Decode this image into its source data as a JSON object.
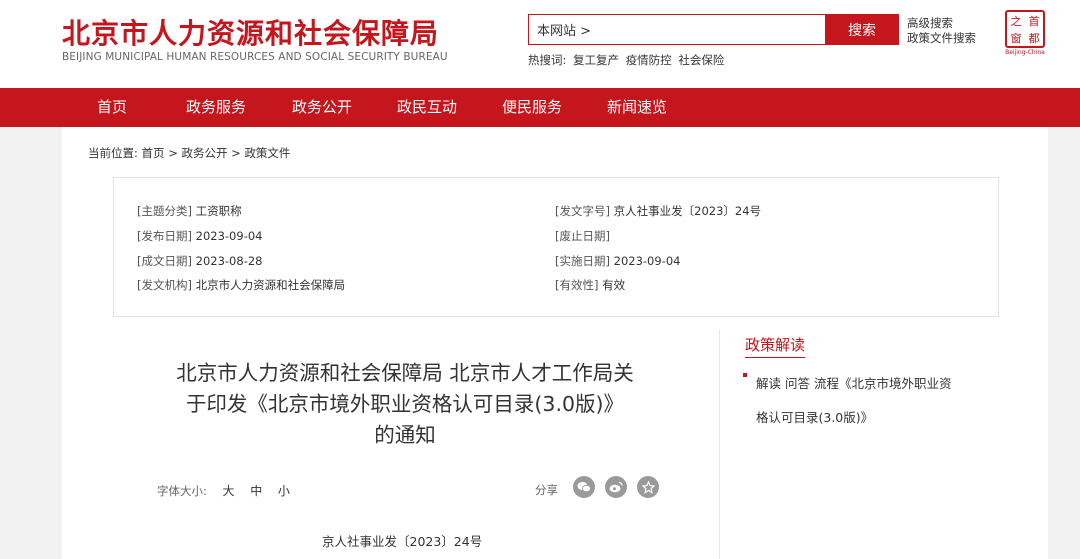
{
  "header": {
    "logo_cn": "北京市人力资源和社会保障局",
    "logo_en": "BEIJING MUNICIPAL HUMAN RESOURCES AND SOCIAL SECURITY BUREAU",
    "search_value": "本网站 >",
    "search_button": "搜索",
    "advanced_search": "高级搜索",
    "policy_search": "政策文件搜索",
    "hot_label": "热搜词:",
    "hot_words": [
      "复工复产",
      "疫情防控",
      "社会保险"
    ],
    "seal_chars": [
      "之",
      "首",
      "窗",
      "都"
    ],
    "seal_en": "Beijing-China"
  },
  "nav": {
    "items": [
      "首页",
      "政务服务",
      "政务公开",
      "政民互动",
      "便民服务",
      "新闻速览"
    ]
  },
  "breadcrumb": {
    "label": "当前位置:",
    "path": [
      "首页",
      "政务公开",
      "政策文件"
    ],
    "sep": ">"
  },
  "meta": {
    "topic_key": "[主题分类]",
    "topic_val": "工资职称",
    "pubdate_key": "[发布日期]",
    "pubdate_val": "2023-09-04",
    "created_key": "[成文日期]",
    "created_val": "2023-08-28",
    "issuer_key": "[发文机构]",
    "issuer_val": "北京市人力资源和社会保障局",
    "docno_key": "[发文字号]",
    "docno_val": "京人社事业发〔2023〕24号",
    "abolish_key": "[废止日期]",
    "abolish_val": "",
    "effective_key": "[实施日期]",
    "effective_val": "2023-09-04",
    "validity_key": "[有效性]",
    "validity_val": "有效"
  },
  "article": {
    "title_line1": "北京市人力资源和社会保障局 北京市人才工作局关",
    "title_line2": "于印发《北京市境外职业资格认可目录(3.0版)》",
    "title_line3": "的通知",
    "font_size_label": "字体大小:",
    "font_large": "大",
    "font_medium": "中",
    "font_small": "小",
    "share_label": "分享",
    "doc_number": "京人社事业发〔2023〕24号"
  },
  "sidebar": {
    "title": "政策解读",
    "link_line1": "解读 问答 流程《北京市境外职业资",
    "link_line2": "格认可目录(3.0版)》"
  },
  "colors": {
    "brand_red": "#c4161c"
  }
}
